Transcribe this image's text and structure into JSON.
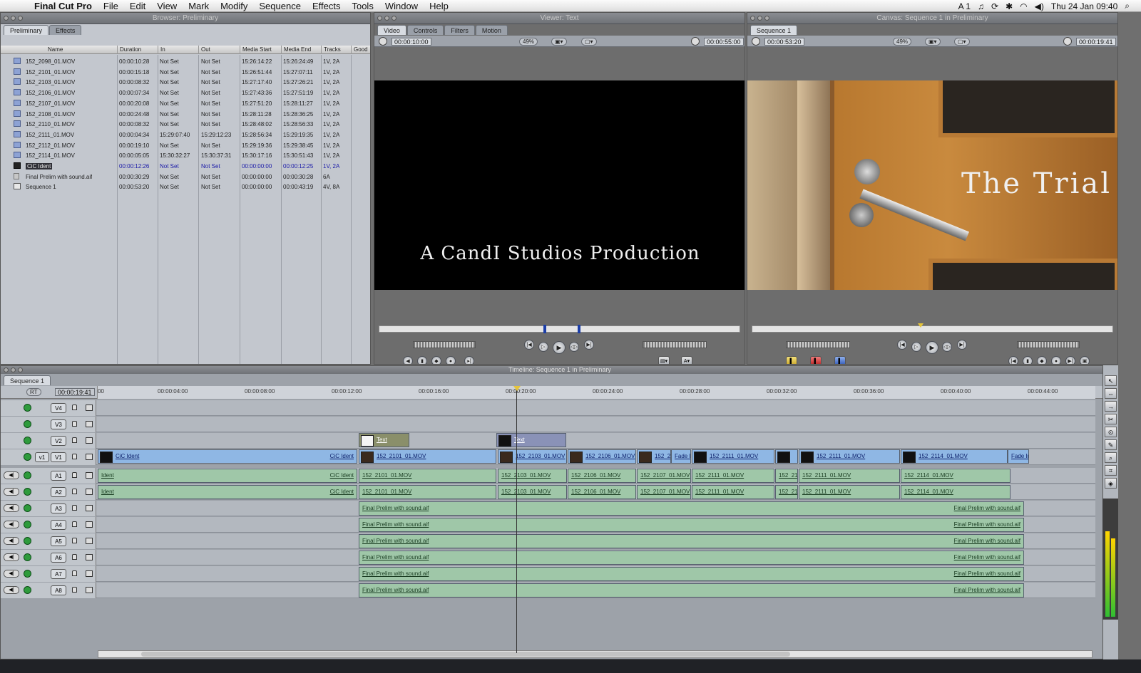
{
  "menubar": {
    "apple": "",
    "app": "Final Cut Pro",
    "items": [
      "File",
      "Edit",
      "View",
      "Mark",
      "Modify",
      "Sequence",
      "Effects",
      "Tools",
      "Window",
      "Help"
    ],
    "status_a": "A 1",
    "datetime": "Thu 24 Jan  09:40"
  },
  "browser": {
    "title": "Browser: Preliminary",
    "tabs": [
      "Preliminary",
      "Effects"
    ],
    "columns": [
      "Name",
      "Duration",
      "In",
      "Out",
      "Media Start",
      "Media End",
      "Tracks",
      "Good"
    ],
    "rows": [
      [
        "152_2098_01.MOV",
        "00:00:10:28",
        "Not Set",
        "Not Set",
        "15:26:14:22",
        "15:26:24:49",
        "1V, 2A"
      ],
      [
        "152_2101_01.MOV",
        "00:00:15:18",
        "Not Set",
        "Not Set",
        "15:26:51:44",
        "15:27:07:11",
        "1V, 2A"
      ],
      [
        "152_2103_01.MOV",
        "00:00:08:32",
        "Not Set",
        "Not Set",
        "15:27:17:40",
        "15:27:26:21",
        "1V, 2A"
      ],
      [
        "152_2106_01.MOV",
        "00:00:07:34",
        "Not Set",
        "Not Set",
        "15:27:43:36",
        "15:27:51:19",
        "1V, 2A"
      ],
      [
        "152_2107_01.MOV",
        "00:00:20:08",
        "Not Set",
        "Not Set",
        "15:27:51:20",
        "15:28:11:27",
        "1V, 2A"
      ],
      [
        "152_2108_01.MOV",
        "00:00:24:48",
        "Not Set",
        "Not Set",
        "15:28:11:28",
        "15:28:36:25",
        "1V, 2A"
      ],
      [
        "152_2110_01.MOV",
        "00:00:08:32",
        "Not Set",
        "Not Set",
        "15:28:48:02",
        "15:28:56:33",
        "1V, 2A"
      ],
      [
        "152_2111_01.MOV",
        "00:00:04:34",
        "15:29:07:40",
        "15:29:12:23",
        "15:28:56:34",
        "15:29:19:35",
        "1V, 2A"
      ],
      [
        "152_2112_01.MOV",
        "00:00:19:10",
        "Not Set",
        "Not Set",
        "15:29:19:36",
        "15:29:38:45",
        "1V, 2A"
      ],
      [
        "152_2114_01.MOV",
        "00:00:05:05",
        "15:30:32:27",
        "15:30:37:31",
        "15:30:17:16",
        "15:30:51:43",
        "1V, 2A"
      ],
      [
        "CiC Ident",
        "00:00:12:26",
        "Not Set",
        "Not Set",
        "00:00:00:00",
        "00:00:12:25",
        "1V, 2A"
      ],
      [
        "Final Prelim  with sound.aif",
        "00:00:30:29",
        "Not Set",
        "Not Set",
        "00:00:00:00",
        "00:00:30:28",
        "6A"
      ],
      [
        "Sequence 1",
        "00:00:53:20",
        "Not Set",
        "Not Set",
        "00:00:00:00",
        "00:00:43:19",
        "4V, 8A"
      ]
    ],
    "row_icons": [
      "clip",
      "clip",
      "clip",
      "clip",
      "clip",
      "clip",
      "clip",
      "clip",
      "clip",
      "clip",
      "dark",
      "aud",
      "seq"
    ]
  },
  "viewer": {
    "title": "Viewer: Text",
    "tabs": [
      "Video",
      "Controls",
      "Filters",
      "Motion"
    ],
    "tc_duration": "00:00:10:00",
    "zoom": "49%",
    "tc_current": "00:00:55:00",
    "frame_text": "A CandI Studios Production"
  },
  "canvas": {
    "title": "Canvas: Sequence 1 in Preliminary",
    "tabs": [
      "Sequence 1"
    ],
    "tc_duration": "00:00:53:20",
    "zoom": "49%",
    "tc_current": "00:00:19:41",
    "frame_text": "The Trial"
  },
  "timeline": {
    "title": "Timeline: Sequence 1 in Preliminary",
    "tab": "Sequence 1",
    "rt": "RT",
    "timecode": "00:00:19:41",
    "ticks": [
      "00",
      "00:00:04:00",
      "00:00:08:00",
      "00:00:12:00",
      "00:00:16:00",
      "00:00:20:00",
      "00:00:24:00",
      "00:00:28:00",
      "00:00:32:00",
      "00:00:36:00",
      "00:00:40:00",
      "00:00:44:00"
    ],
    "video_tracks": [
      "V4",
      "V3",
      "V2",
      "V1"
    ],
    "audio_tracks": [
      "A1",
      "A2",
      "A3",
      "A4",
      "A5",
      "A6",
      "A7",
      "A8"
    ],
    "v1_src": "v1",
    "clips": {
      "ident": "CiC Ident",
      "ident_short": "Ident",
      "text": "Text",
      "fade": "Fade In",
      "c2101": "152_2101_01.MOV",
      "c2103": "152_2103_01.MOV",
      "c2106": "152_2106_01.MOV",
      "c2107": "152_2107_01.MOV",
      "c2111": "152_2111_01.MOV",
      "c2114": "152_2114_01.MOV",
      "c2111short": "152_211",
      "c2107short": "152_2",
      "sound": "Final Prelim  with sound.aif"
    }
  }
}
